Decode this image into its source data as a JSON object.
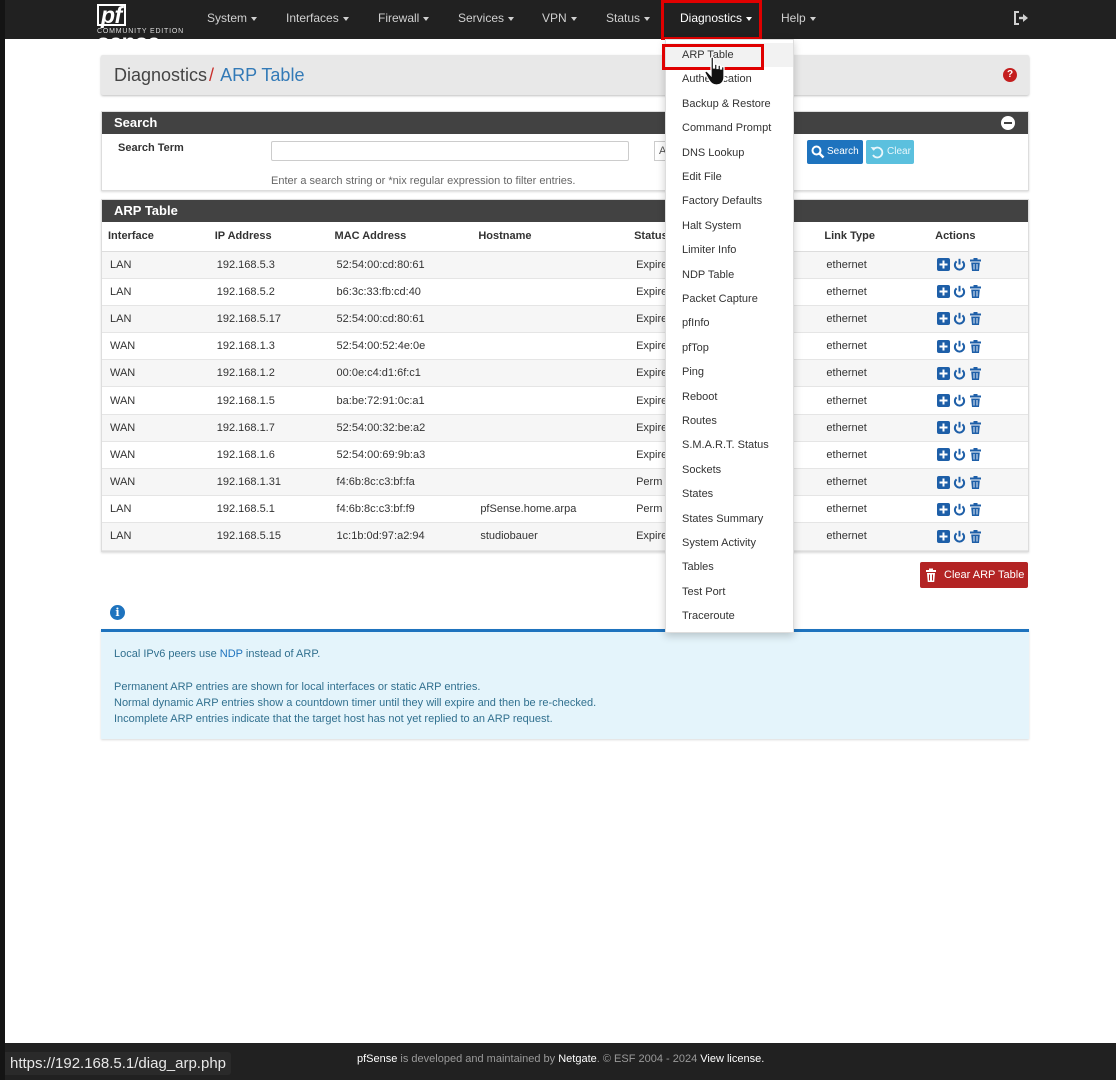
{
  "navbar": {
    "logo_main": "sense",
    "logo_pf": "pf",
    "logo_sub": "COMMUNITY EDITION",
    "items": [
      {
        "label": "System"
      },
      {
        "label": "Interfaces"
      },
      {
        "label": "Firewall"
      },
      {
        "label": "Services"
      },
      {
        "label": "VPN"
      },
      {
        "label": "Status"
      },
      {
        "label": "Diagnostics"
      },
      {
        "label": "Help"
      }
    ]
  },
  "breadcrumb": {
    "parent": "Diagnostics",
    "separator": "/",
    "current": "ARP Table"
  },
  "search_panel": {
    "title": "Search",
    "term_label": "Search Term",
    "term_value": "",
    "select_value": "A",
    "search_button": "Search",
    "clear_button": "Clear",
    "help_text": "Enter a search string or *nix regular expression to filter entries."
  },
  "arp_panel": {
    "title": "ARP Table",
    "columns": [
      "Interface",
      "IP Address",
      "MAC Address",
      "Hostname",
      "Status",
      "Link Type",
      "Actions"
    ],
    "rows": [
      {
        "interface": "LAN",
        "ip": "192.168.5.3",
        "mac": "52:54:00:cd:80:61",
        "hostname": "",
        "status": "Expire",
        "link": "ethernet"
      },
      {
        "interface": "LAN",
        "ip": "192.168.5.2",
        "mac": "b6:3c:33:fb:cd:40",
        "hostname": "",
        "status": "Expire",
        "link": "ethernet"
      },
      {
        "interface": "LAN",
        "ip": "192.168.5.17",
        "mac": "52:54:00:cd:80:61",
        "hostname": "",
        "status": "Expire",
        "link": "ethernet"
      },
      {
        "interface": "WAN",
        "ip": "192.168.1.3",
        "mac": "52:54:00:52:4e:0e",
        "hostname": "",
        "status": "Expire",
        "link": "ethernet"
      },
      {
        "interface": "WAN",
        "ip": "192.168.1.2",
        "mac": "00:0e:c4:d1:6f:c1",
        "hostname": "",
        "status": "Expire",
        "link": "ethernet"
      },
      {
        "interface": "WAN",
        "ip": "192.168.1.5",
        "mac": "ba:be:72:91:0c:a1",
        "hostname": "",
        "status": "Expire",
        "link": "ethernet"
      },
      {
        "interface": "WAN",
        "ip": "192.168.1.7",
        "mac": "52:54:00:32:be:a2",
        "hostname": "",
        "status": "Expire",
        "link": "ethernet"
      },
      {
        "interface": "WAN",
        "ip": "192.168.1.6",
        "mac": "52:54:00:69:9b:a3",
        "hostname": "",
        "status": "Expire",
        "link": "ethernet"
      },
      {
        "interface": "WAN",
        "ip": "192.168.1.31",
        "mac": "f4:6b:8c:c3:bf:fa",
        "hostname": "",
        "status": "Perm",
        "link": "ethernet"
      },
      {
        "interface": "LAN",
        "ip": "192.168.5.1",
        "mac": "f4:6b:8c:c3:bf:f9",
        "hostname": "pfSense.home.arpa",
        "status": "Perm",
        "link": "ethernet"
      },
      {
        "interface": "LAN",
        "ip": "192.168.5.15",
        "mac": "1c:1b:0d:97:a2:94",
        "hostname": "studiobauer",
        "status": "Expire",
        "link": "ethernet"
      }
    ],
    "clear_button": "Clear ARP Table"
  },
  "info": {
    "line1_pre": "Local IPv6 peers use ",
    "line1_link": "NDP",
    "line1_post": " instead of ARP.",
    "line2": "Permanent ARP entries are shown for local interfaces or static ARP entries.",
    "line3": "Normal dynamic ARP entries show a countdown timer until they will expire and then be re-checked.",
    "line4": "Incomplete ARP entries indicate that the target host has not yet replied to an ARP request."
  },
  "dropdown": {
    "items": [
      "ARP Table",
      "Authentication",
      "Backup & Restore",
      "Command Prompt",
      "DNS Lookup",
      "Edit File",
      "Factory Defaults",
      "Halt System",
      "Limiter Info",
      "NDP Table",
      "Packet Capture",
      "pfInfo",
      "pfTop",
      "Ping",
      "Reboot",
      "Routes",
      "S.M.A.R.T. Status",
      "Sockets",
      "States",
      "States Summary",
      "System Activity",
      "Tables",
      "Test Port",
      "Traceroute"
    ]
  },
  "footer": {
    "brand": "pfSense",
    "mid": " is developed and maintained by ",
    "company": "Netgate",
    "copy": ". © ESF 2004 - 2024 ",
    "license": "View license."
  },
  "status_url": "https://192.168.5.1/diag_arp.php",
  "colors": {
    "navbar": "#212121",
    "highlight": "#e00000",
    "primary": "#1e73be",
    "danger": "#b32424"
  }
}
